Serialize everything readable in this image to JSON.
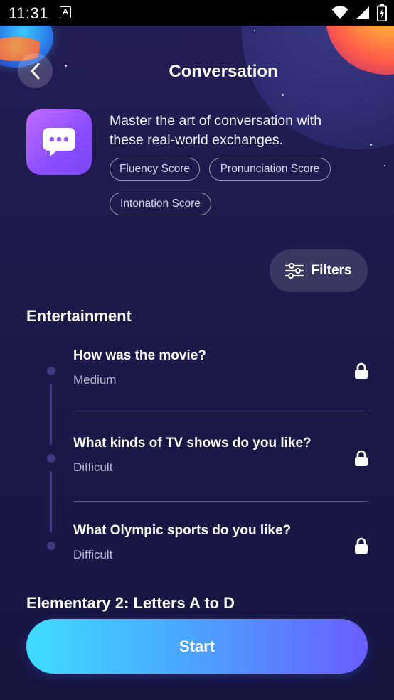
{
  "status_bar": {
    "time": "11:31",
    "notification_glyph": "A",
    "icons": [
      "wifi-icon",
      "signal-icon",
      "battery-icon"
    ]
  },
  "header": {
    "title": "Conversation",
    "back_icon": "chevron-left-icon"
  },
  "intro": {
    "icon": "chat-bubble-icon",
    "description": "Master the art of conversation with these real-world exchanges.",
    "chips": [
      "Fluency Score",
      "Pronunciation Score",
      "Intonation Score"
    ]
  },
  "filters": {
    "label": "Filters",
    "icon": "sliders-icon"
  },
  "sections": [
    {
      "title": "Entertainment",
      "items": [
        {
          "title": "How was the movie?",
          "level": "Medium",
          "locked": true
        },
        {
          "title": "What kinds of TV shows do you like?",
          "level": "Difficult",
          "locked": true
        },
        {
          "title": "What Olympic sports do you like?",
          "level": "Difficult",
          "locked": true
        }
      ]
    },
    {
      "title": "Elementary 2: Letters A to D",
      "items": []
    }
  ],
  "start_button": {
    "label": "Start"
  },
  "colors": {
    "background": "#1d1a4a",
    "accent_purple": "#8a4dff",
    "start_gradient_start": "#3fdcff",
    "start_gradient_end": "#6a5dff",
    "timeline": "#3d3a82"
  }
}
